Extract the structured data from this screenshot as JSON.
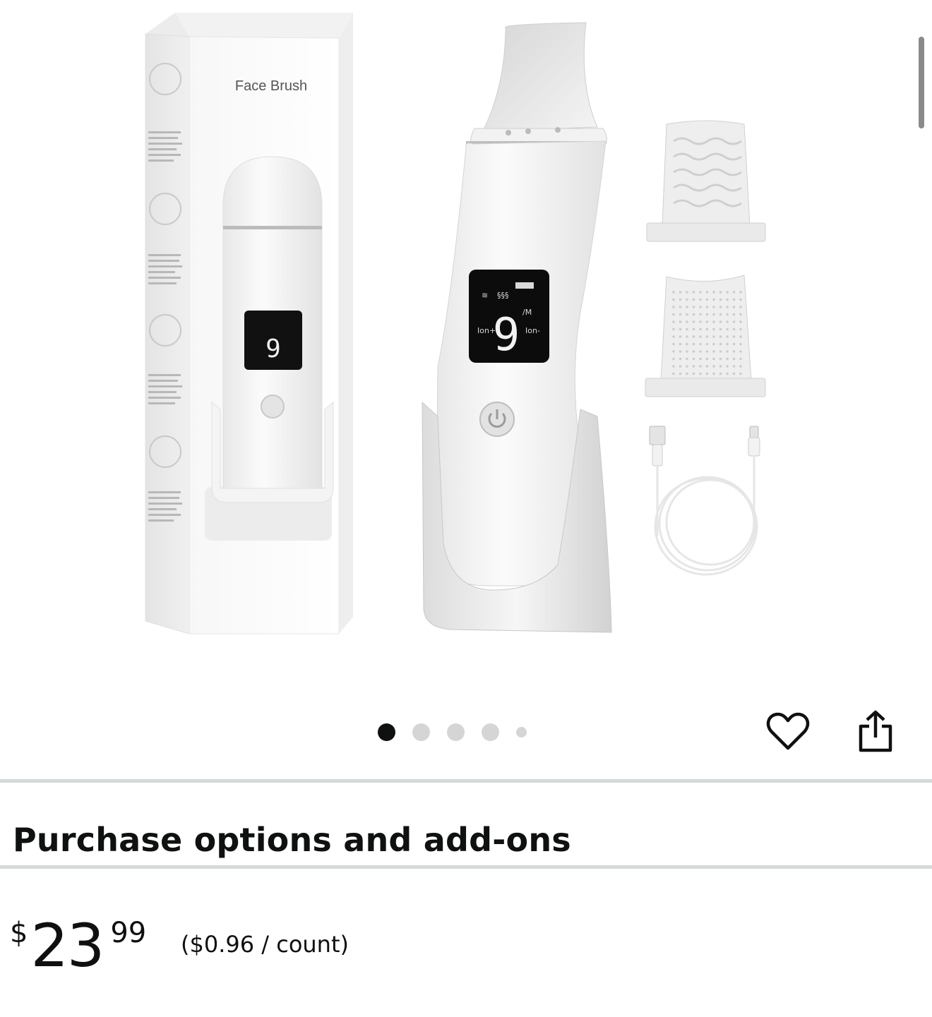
{
  "product_image": {
    "box_label": "Face Brush",
    "display_digit": "9",
    "display_mode": "/M",
    "display_left": "Ion+",
    "display_right": "Ion-"
  },
  "carousel": {
    "total": 5,
    "active_index": 0
  },
  "actions": {
    "favorite_icon": "heart-icon",
    "share_icon": "share-icon"
  },
  "section": {
    "title": "Purchase options and add-ons"
  },
  "price": {
    "symbol": "$",
    "whole": "23",
    "fraction": "99",
    "unit": "($0.96 / count)"
  }
}
